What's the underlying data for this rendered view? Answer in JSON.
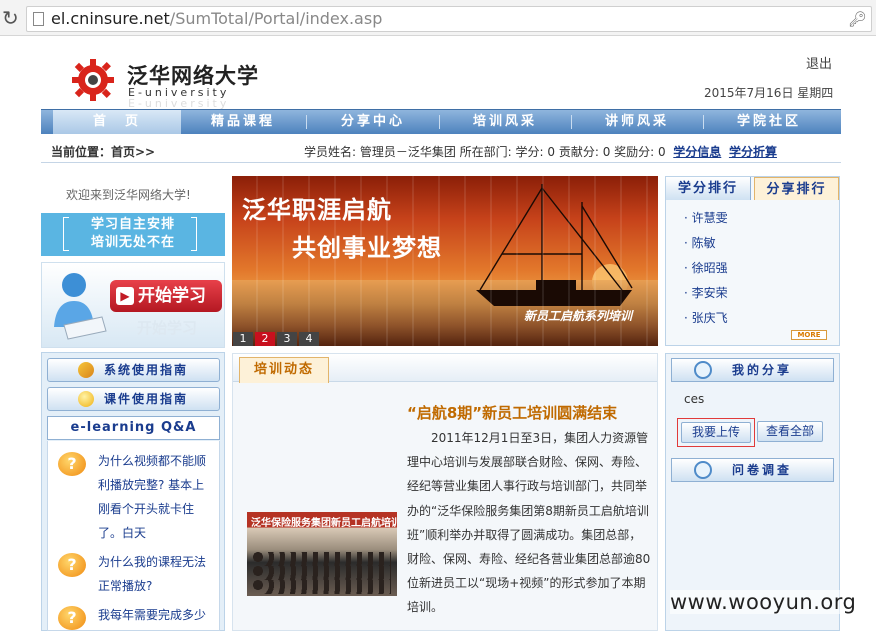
{
  "browser": {
    "url_host": "el.cninsure.net",
    "url_path": "/SumTotal/Portal/index.asp"
  },
  "header": {
    "brand_cn": "泛华网络大学",
    "brand_en": "E-university",
    "logout": "退出",
    "date": "2015年7月16日 星期四"
  },
  "nav": {
    "items": [
      {
        "label": "首　页"
      },
      {
        "label": "精品课程"
      },
      {
        "label": "分享中心"
      },
      {
        "label": "培训风采"
      },
      {
        "label": "讲师风采"
      },
      {
        "label": "学院社区"
      }
    ]
  },
  "subbar": {
    "breadcrumb": "当前位置：首页>>",
    "user_info": "学员姓名: 管理员－泛华集团  所在部门:   学分: 0  贡献分: 0  奖励分: 0",
    "link_credits": "学分信息",
    "link_convert": "学分折算"
  },
  "left": {
    "welcome": "欢迎来到泛华网络大学!",
    "slogan_line1": "学习自主安排",
    "slogan_line2": "培训无处不在",
    "start_label": "开始学习",
    "guide1": "系统使用指南",
    "guide2": "课件使用指南",
    "qa_title": "e-learning Q&A",
    "qa": [
      {
        "text": "为什么视频都不能顺利播放完整? 基本上刚看个开头就卡住了。白天"
      },
      {
        "text": "为什么我的课程无法正常播放?"
      },
      {
        "text": "我每年需要完成多少"
      }
    ]
  },
  "banner": {
    "title1": "泛华职涯启航",
    "title2": "共创事业梦想",
    "caption": "新员工启航系列培训",
    "pages": [
      "1",
      "2",
      "3",
      "4"
    ],
    "active_page": "2"
  },
  "ranking": {
    "tab_study": "学分排行",
    "tab_share": "分享排行",
    "names": [
      "许慧雯",
      "陈敏",
      "徐昭强",
      "李安荣",
      "张庆飞"
    ],
    "more": "MORE"
  },
  "news": {
    "tab": "培训动态",
    "title": "“启航8期”新员工培训圆满结束",
    "body": "2011年12月1日至3日，集团人力资源管理中心培训与发展部联合财险、保网、寿险、经纪等营业集团人事行政与培训部门，共同举办的“泛华保险服务集团第8期新员工启航培训班”顺利举办并取得了圆满成功。集团总部，财险、保网、寿险、经纪各营业集团总部逾80位新进员工以“现场+视频”的形式参加了本期培训。",
    "photo_banner": "泛华保险服务集团新员工启航培训班"
  },
  "right": {
    "my_share": "我的分享",
    "share_item": "ces",
    "upload": "我要上传",
    "view_all": "查看全部",
    "survey": "问卷调查"
  },
  "watermark": "www.wooyun.org",
  "colors": {
    "nav_blue": "#4d82bd",
    "accent_orange": "#c06a00",
    "link_blue": "#1a3c8e",
    "brand_red": "#c8101e"
  }
}
